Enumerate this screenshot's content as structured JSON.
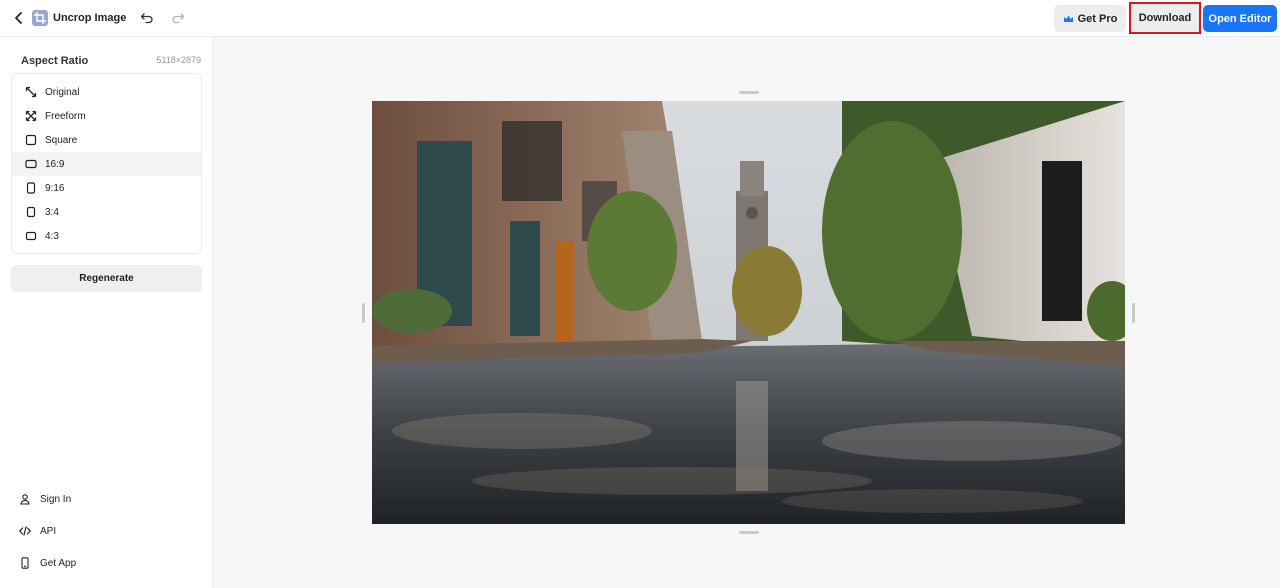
{
  "header": {
    "app_title": "Uncrop Image",
    "get_pro_label": "Get Pro",
    "download_label": "Download",
    "open_editor_label": "Open Editor"
  },
  "sidebar": {
    "aspect_ratio_title": "Aspect Ratio",
    "dimensions": "5118×2879",
    "options": [
      {
        "label": "Original",
        "icon": "expand-diagonal-icon"
      },
      {
        "label": "Freeform",
        "icon": "freeform-icon"
      },
      {
        "label": "Square",
        "icon": "square-icon"
      },
      {
        "label": "16:9",
        "icon": "landscape-rect-icon",
        "selected": true
      },
      {
        "label": "9:16",
        "icon": "portrait-rect-icon"
      },
      {
        "label": "3:4",
        "icon": "portrait-rect-icon"
      },
      {
        "label": "4:3",
        "icon": "landscape-rect-icon"
      }
    ],
    "regenerate_label": "Regenerate",
    "bottom": {
      "sign_in": "Sign In",
      "api": "API",
      "get_app": "Get App"
    }
  },
  "colors": {
    "primary": "#1976f5",
    "highlight_border": "#e0141c"
  }
}
